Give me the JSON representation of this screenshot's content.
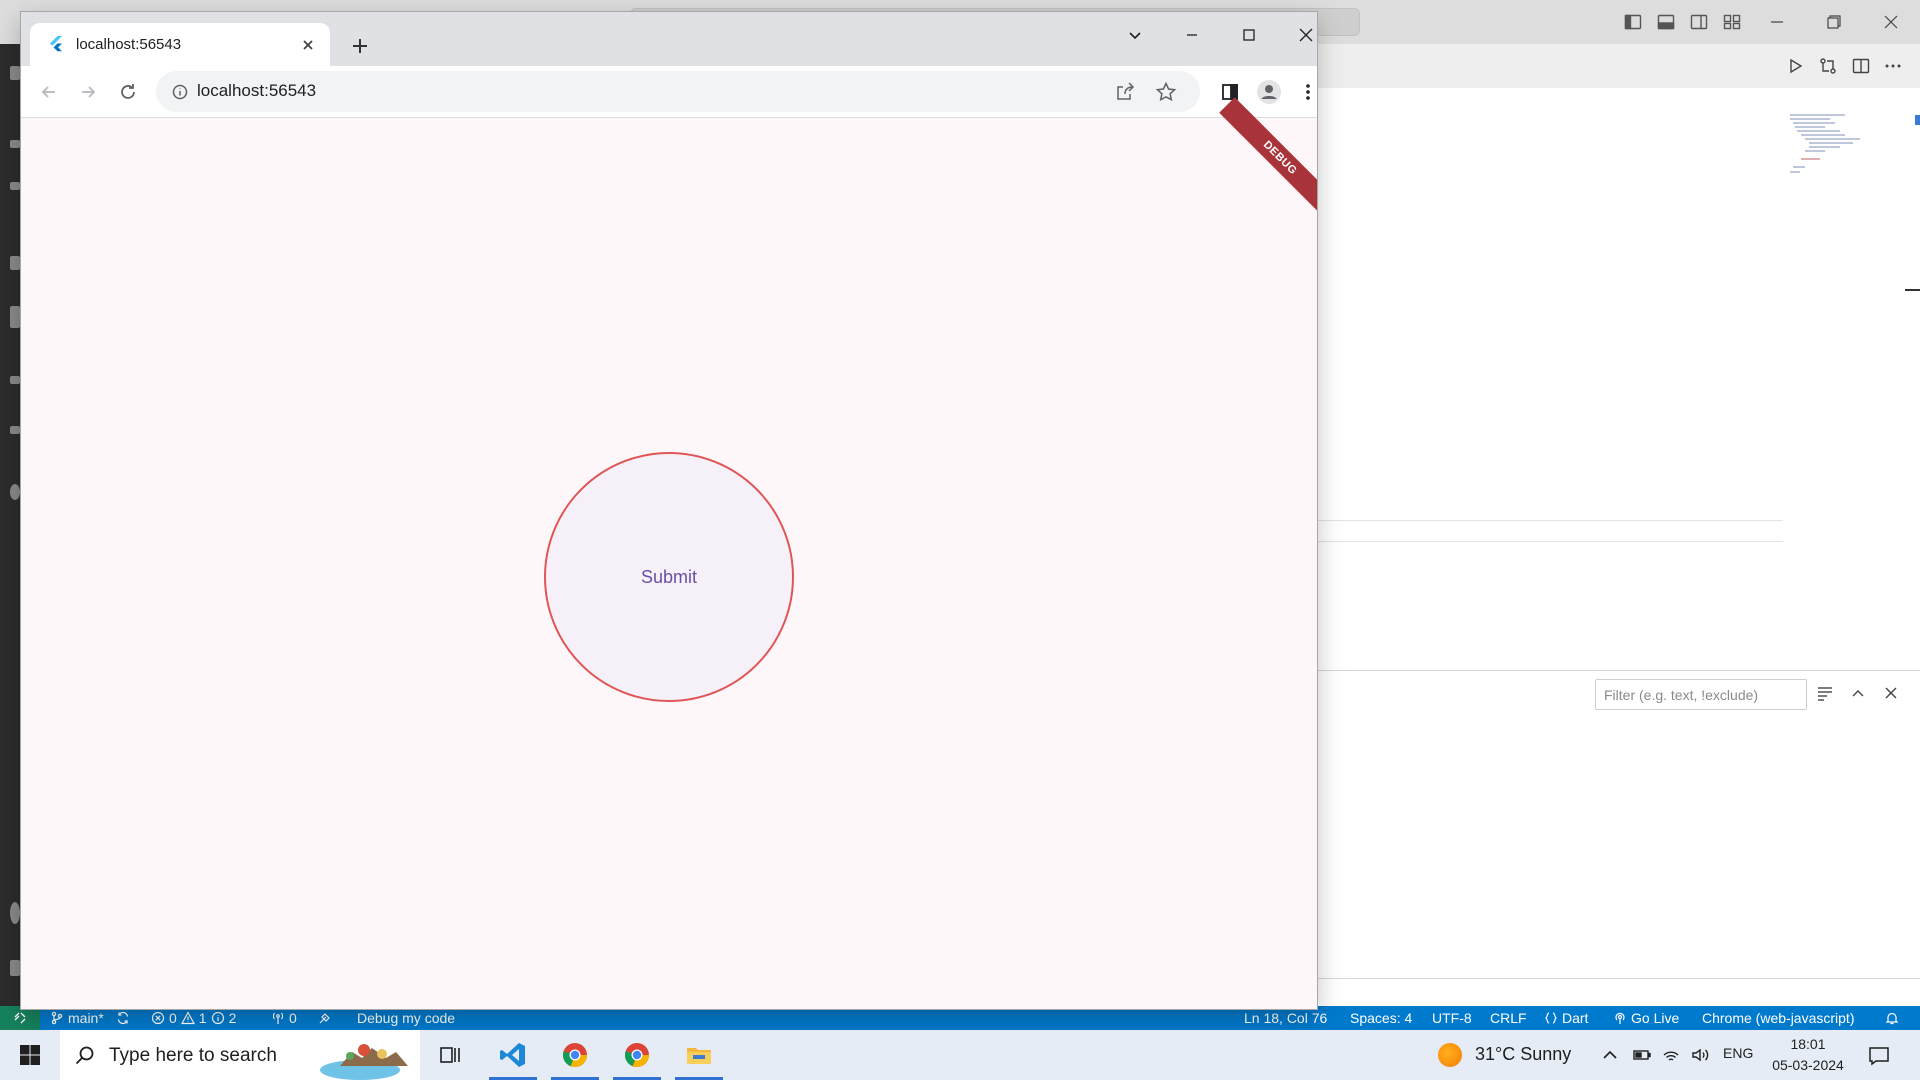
{
  "browser": {
    "tab_title": "localhost:56543",
    "address": "localhost:56543"
  },
  "app": {
    "debug_banner": "DEBUG",
    "submit_label": "Submit",
    "colors": {
      "border": "#e05656",
      "fill": "#f6f1f8",
      "text": "#6a4fa5",
      "page_bg": "#fef7fa"
    }
  },
  "vscode": {
    "filter_placeholder": "Filter (e.g. text, !exclude)",
    "status": {
      "branch": "main*",
      "errors": "0",
      "warnings": "1",
      "infos": "2",
      "ports": "0",
      "debug_config": "Debug my code",
      "cursor": "Ln 18, Col 76",
      "spaces": "Spaces: 4",
      "encoding": "UTF-8",
      "eol": "CRLF",
      "language": "Dart",
      "go_live": "Go Live",
      "device": "Chrome (web-javascript)"
    }
  },
  "taskbar": {
    "search_text": "Type here to search",
    "weather": "31°C  Sunny",
    "language": "ENG",
    "time": "18:01",
    "date": "05-03-2024"
  }
}
